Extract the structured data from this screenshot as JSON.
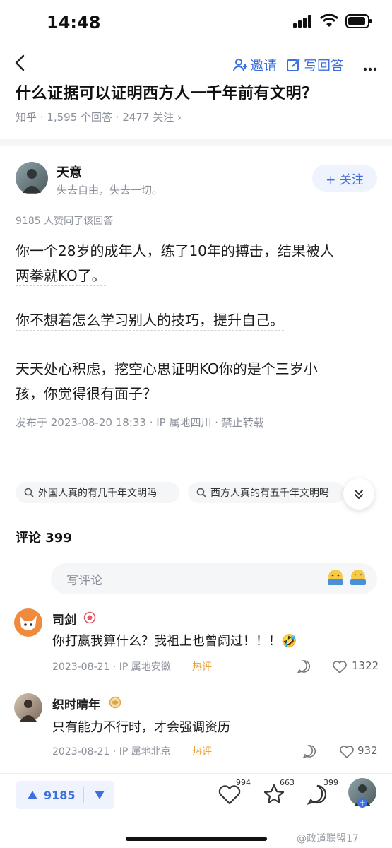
{
  "status_bar": {
    "time": "14:48"
  },
  "topbar": {
    "invite_label": "邀请",
    "write_label": "写回答"
  },
  "question": {
    "title": "什么证据可以证明西方人一千年前有文明？",
    "meta": "知乎 · 1,595 个回答 · 2477 关注 ›"
  },
  "author": {
    "name": "天意",
    "bio": "失去自由，失去一切。",
    "follow_label": "+ 关注"
  },
  "answer": {
    "vote_line": "9185 人赞同了该回答",
    "p1_line1": "你一个28岁的成年人，练了10年的搏击，结果被人",
    "p1_line2": "两拳就KO了。",
    "p2": "你不想着怎么学习别人的技巧，提升自己。",
    "p3_line1": "天天处心积虑，挖空心思证明KO你的是个三岁小",
    "p3_line2": "孩，你觉得很有面子？",
    "published": "发布于 2023-08-20 18:33 · IP 属地四川 · 禁止转载"
  },
  "related_searches": [
    "外国人真的有几千年文明吗",
    "西方人真的有五千年文明吗"
  ],
  "comments_header": {
    "label": "评论 399"
  },
  "comment_input": {
    "placeholder": "写评论"
  },
  "comments": [
    {
      "name": "司剑",
      "text": "你打赢我算什么？我祖上也曾阔过！！！🤣",
      "date": "2023-08-21 · IP 属地安徽",
      "hot": "热评",
      "likes": "1322"
    },
    {
      "name": "织时晴年",
      "text": "只有能力不行时，才会强调资历",
      "date": "2023-08-21 · IP 属地北京",
      "hot": "热评",
      "likes": "932"
    }
  ],
  "bottom_bar": {
    "upvotes": "9185",
    "likes": "994",
    "favorites": "663",
    "comments": "399"
  },
  "watermark": "@政道联盟17",
  "colors": {
    "accent": "#3d6fe0",
    "muted": "#8a8f99",
    "hot": "#e8a33c"
  }
}
